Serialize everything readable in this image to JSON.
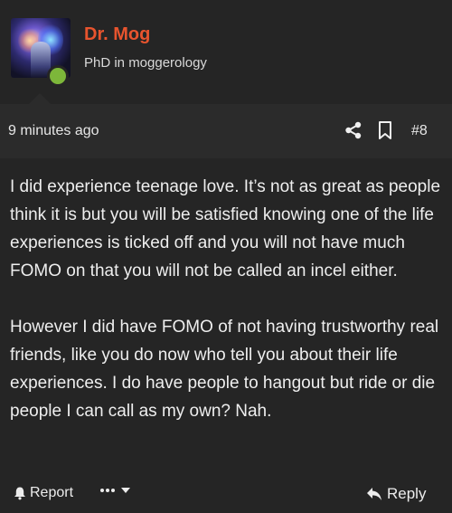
{
  "author": {
    "name": "Dr. Mog",
    "title": "PhD in moggerology",
    "status": "online",
    "name_color": "#e8542e",
    "status_color": "#7db73a"
  },
  "meta": {
    "timestamp": "9 minutes ago",
    "post_number": "#8"
  },
  "post": {
    "paragraphs": [
      "I did experience teenage love. It’s not as great as people think it is but you will be satisfied knowing one of the life experiences is ticked off and you will not have much FOMO on that you will not be called an incel either.",
      "However I did have FOMO of not having trustworthy real friends, like you do now who tell you about their life experiences. I do have people to hangout but ride or die people I can call as my own? Nah."
    ]
  },
  "footer": {
    "report_label": "Report",
    "reply_label": "Reply"
  },
  "icons": [
    "share-icon",
    "bookmark-icon",
    "bell-icon",
    "ellipsis-icon",
    "chevron-down-icon",
    "reply-icon"
  ]
}
